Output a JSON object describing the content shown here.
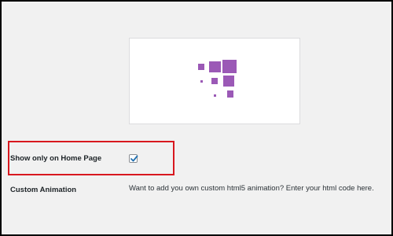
{
  "preview": {
    "loader_icon": "pixel-squares-loader-icon",
    "loader_color": "#9b59b6"
  },
  "settings": {
    "show_home": {
      "label": "Show only on Home Page",
      "checked": true,
      "check_color": "#2271b1"
    },
    "custom_animation": {
      "label": "Custom Animation",
      "description": "Want to add you own custom html5 animation? Enter your html code here."
    }
  },
  "highlight_color": "#d8181f"
}
